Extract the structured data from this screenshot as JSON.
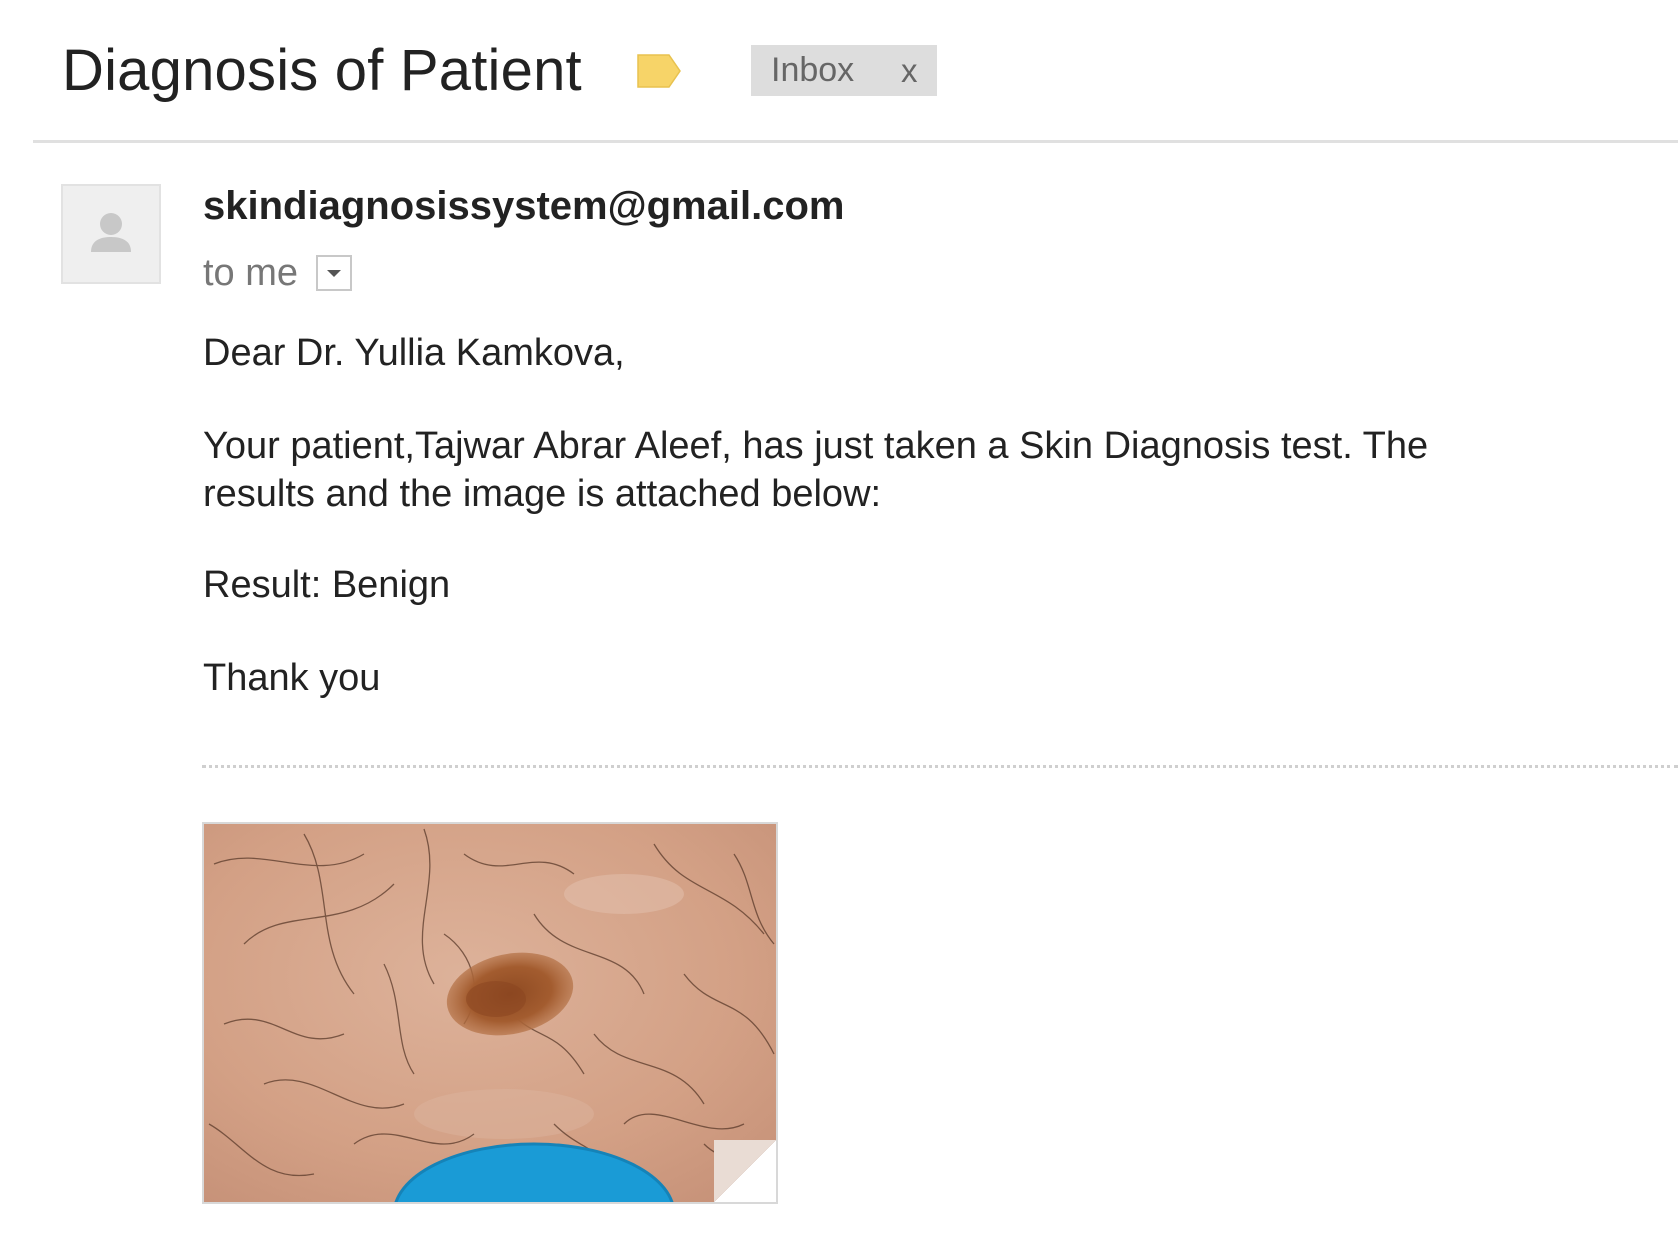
{
  "email": {
    "subject": "Diagnosis of Patient",
    "label_icon": "label-tag-icon",
    "label_color": "#f7d468",
    "chip": {
      "label": "Inbox",
      "remove": "x"
    },
    "sender": "skindiagnosissystem@gmail.com",
    "recipient": "to me",
    "avatar_icon": "person-icon",
    "details_icon": "chevron-down-icon",
    "body": {
      "greeting": "Dear Dr. Yullia Kamkova,",
      "paragraph_line1": "Your patient,Tajwar Abrar Aleef, has just taken a Skin Diagnosis test. The",
      "paragraph_line2": "results and the image is attached below:",
      "result": "Result: Benign",
      "closing": "Thank you"
    },
    "attachment": {
      "kind": "image",
      "depicts": "skin-lesion-photo",
      "colors": {
        "skin": "#d5a58c",
        "lesion": "#a05a2c",
        "marker": "#1a9bd6"
      }
    }
  }
}
